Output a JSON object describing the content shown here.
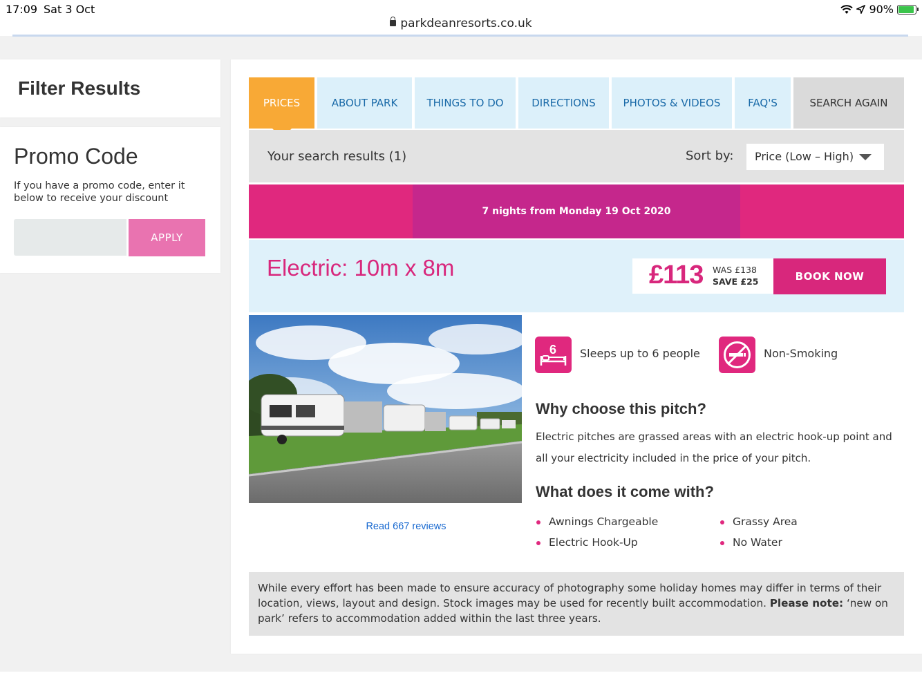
{
  "status_bar": {
    "time": "17:09",
    "date": "Sat 3 Oct",
    "battery": "90%",
    "battery_level": 0.9,
    "url": "parkdeanresorts.co.uk"
  },
  "filter": {
    "title": "Filter Results"
  },
  "promo": {
    "title": "Promo Code",
    "description": "If you have a promo code, enter it below to receive your discount",
    "input_value": "",
    "apply_label": "APPLY"
  },
  "tabs": [
    {
      "label": "PRICES",
      "active": true
    },
    {
      "label": "ABOUT PARK"
    },
    {
      "label": "THINGS TO DO"
    },
    {
      "label": "DIRECTIONS"
    },
    {
      "label": "PHOTOS & VIDEOS"
    },
    {
      "label": "FAQ'S"
    },
    {
      "label": "SEARCH AGAIN"
    }
  ],
  "results": {
    "count_text": "Your search results (1)",
    "sort_label": "Sort by:",
    "sort_value": "Price (Low – High)"
  },
  "date_band": "7 nights from Monday 19 Oct 2020",
  "pitch": {
    "title": "Electric: 10m x 8m",
    "price": "£113",
    "was": "WAS £138",
    "save": "SAVE £25",
    "book_label": "BOOK NOW",
    "reviews_link": "Read 667 reviews"
  },
  "features": [
    {
      "icon": "bed-icon",
      "badge": "6",
      "text": "Sleeps up to 6 people"
    },
    {
      "icon": "no-smoking-icon",
      "text": "Non-Smoking"
    }
  ],
  "why": {
    "title": "Why choose this pitch?",
    "body": "Electric pitches are grassed areas with an electric hook-up point and all your electricity included in the price of your pitch."
  },
  "comes_with": {
    "title": "What does it come with?",
    "items": [
      "Awnings Chargeable",
      "Grassy Area",
      "Electric Hook-Up",
      "No Water"
    ]
  },
  "disclaimer": {
    "text": "While every effort has been made to ensure accuracy of photography some holiday homes may differ in terms of their location, views, layout and design. Stock images may be used for recently built accommodation.",
    "note_label": "Please note:",
    "note_text": "‘new on park’ refers to accommodation added within the last three years."
  },
  "colors": {
    "brand_pink": "#d8277c",
    "active_tab": "#f8a936",
    "tab_bg": "#dcf0fa",
    "link_blue": "#1a6ad0"
  }
}
